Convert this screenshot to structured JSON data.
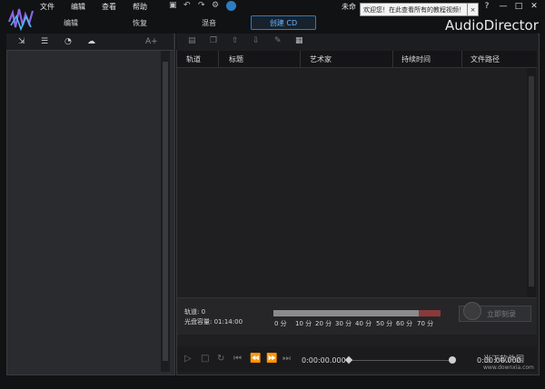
{
  "app": {
    "name": "AudioDirector"
  },
  "menu": [
    {
      "label": "文件"
    },
    {
      "label": "编辑"
    },
    {
      "label": "查看"
    },
    {
      "label": "帮助"
    }
  ],
  "user": {
    "name": "未命"
  },
  "notification": {
    "text": "欢迎您！在此查看所有的教程视频！",
    "close": "×"
  },
  "window_controls": {
    "help": "?",
    "minimize": "—",
    "maximize": "□",
    "close": "✕"
  },
  "modes": [
    {
      "label": "编辑"
    },
    {
      "label": "恢复"
    },
    {
      "label": "混音"
    },
    {
      "label": "创建 CD",
      "active": true
    }
  ],
  "left_toolbar": {
    "items": [
      "import-icon",
      "add-to-list-icon",
      "cd-rip-icon",
      "cloud-icon"
    ],
    "font_size_label": "A+"
  },
  "track_table": {
    "columns": [
      "轨道",
      "标题",
      "艺术家",
      "持续时间",
      "文件路径"
    ],
    "rows": []
  },
  "disc_info": {
    "tracks_label": "轨道: 0",
    "capacity_label": "光盘容量: 01:14:00",
    "scale": [
      "0 分",
      "10 分",
      "20 分",
      "30 分",
      "40 分",
      "50 分",
      "60 分",
      "70 分"
    ],
    "burn_label": "立即刻录"
  },
  "transport": {
    "time": "0:00:00.000",
    "duration": "0:00:00.000"
  },
  "watermark": {
    "text1": "当下软件园",
    "text2": "www.downxia.com"
  },
  "colors": {
    "accent": "#2e7cc0",
    "accent_text": "#6cb3ff",
    "capacity_overflow": "#8a3a3a"
  }
}
